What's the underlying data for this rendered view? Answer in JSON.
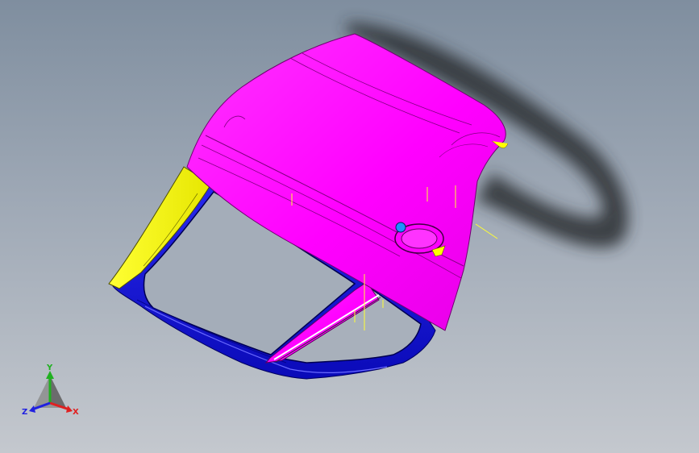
{
  "viewport": {
    "background_top": "#7f8e9f",
    "background_bottom": "#c4c8ce"
  },
  "model": {
    "outer_panel_color": "#ff00ff",
    "inner_frame_color": "#1414e6",
    "pillar_color": "#ffff00",
    "shadow_color": "#2a2e33"
  },
  "triad": {
    "x_label": "X",
    "y_label": "Y",
    "z_label": "Z",
    "x_color": "#e02020",
    "y_color": "#20b020",
    "z_color": "#2020e0"
  }
}
